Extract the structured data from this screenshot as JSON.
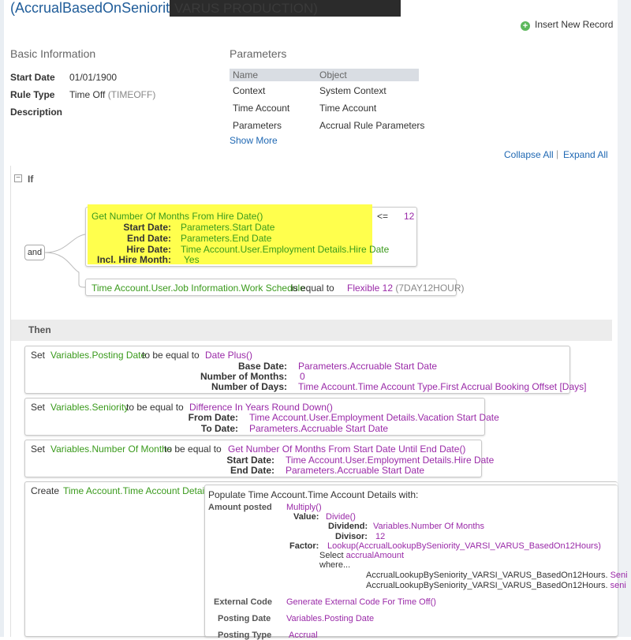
{
  "header": {
    "title": "(AccrualBasedOnSeniority",
    "title_obscured": "VARUS PRODUCTION)",
    "insert_button": "Insert New Record"
  },
  "basic_info": {
    "heading": "Basic Information",
    "start_date_label": "Start Date",
    "start_date_value": "01/01/1900",
    "rule_type_label": "Rule Type",
    "rule_type_value": "Time Off",
    "rule_type_code": "(TIMEOFF)",
    "description_label": "Description"
  },
  "parameters": {
    "heading": "Parameters",
    "col_name": "Name",
    "col_object": "Object",
    "rows": [
      {
        "name": "Context",
        "object": "System Context"
      },
      {
        "name": "Time Account",
        "object": "Time Account"
      },
      {
        "name": "Parameters",
        "object": "Accrual Rule Parameters"
      }
    ],
    "show_more": "Show More"
  },
  "controls": {
    "collapse_all": "Collapse All",
    "separator": "|",
    "expand_all": "Expand All"
  },
  "if_block": {
    "label": "If",
    "and_label": "and",
    "cond1": {
      "func": "Get Number Of Months From Hire Date()",
      "op": "<=",
      "value": "12",
      "params": [
        {
          "label": "Start Date:",
          "value": "Parameters.Start Date"
        },
        {
          "label": "End Date:",
          "value": "Parameters.End Date"
        },
        {
          "label": "Hire Date:",
          "value": "Time Account.User.Employment Details.Hire Date"
        },
        {
          "label": "Incl. Hire Month:",
          "value": "Yes"
        }
      ]
    },
    "cond2": {
      "field": "Time Account.User.Job Information.Work Schedule",
      "op": "is equal to",
      "value": "Flexible 12",
      "code": "(7DAY12HOUR)"
    }
  },
  "then_block": {
    "label": "Then",
    "set1": {
      "kw": "Set",
      "var": "Variables.Posting Date",
      "op": "to be equal to",
      "func": "Date Plus()",
      "params": [
        {
          "label": "Base Date:",
          "value": "Parameters.Accruable Start Date"
        },
        {
          "label": "Number of Months:",
          "value": "0"
        },
        {
          "label": "Number of Days:",
          "value": "Time Account.Time Account Type.First Accrual Booking Offset [Days]"
        }
      ]
    },
    "set2": {
      "kw": "Set",
      "var": "Variables.Seniority",
      "op": "to be equal to",
      "func": "Difference In Years Round Down()",
      "params": [
        {
          "label": "From Date:",
          "value": "Time Account.User.Employment Details.Vacation Start Date"
        },
        {
          "label": "To Date:",
          "value": "Parameters.Accruable Start Date"
        }
      ]
    },
    "set3": {
      "kw": "Set",
      "var": "Variables.Number Of Months",
      "op": "to be equal to",
      "func": "Get Number Of Months From Start Date Until End Date()",
      "params": [
        {
          "label": "Start Date:",
          "value": "Time Account.User.Employment Details.Hire Date"
        },
        {
          "label": "End Date:",
          "value": "Parameters.Accruable Start Date"
        }
      ]
    },
    "create": {
      "kw": "Create",
      "target": "Time Account.Time Account Details",
      "populate": "Populate Time Account.Time Account Details with:",
      "amount_label": "Amount posted",
      "multiply": "Multiply()",
      "value_label": "Value:",
      "divide": "Divide()",
      "dividend_label": "Dividend:",
      "dividend_value": "Variables.Number Of Months",
      "divisor_label": "Divisor:",
      "divisor_value": "12",
      "factor_label": "Factor:",
      "lookup": "Lookup(AccrualLookupBySeniority_VARSI_VARUS_BasedOn12Hours)",
      "select_kw": "Select",
      "select_field": "accrualAmount",
      "where_kw": "where...",
      "where1_a": "AccrualLookupBySeniority_VARSI_VARUS_BasedOn12Hours.",
      "where1_b": "Seni",
      "where2_a": "AccrualLookupBySeniority_VARSI_VARUS_BasedOn12Hours.",
      "where2_b": "seni",
      "ext_label": "External Code",
      "ext_value": "Generate External Code For Time Off()",
      "posting_date_label": "Posting Date",
      "posting_date_value": "Variables.Posting Date",
      "posting_type_label": "Posting Type",
      "posting_type_value": "Accrual"
    }
  }
}
